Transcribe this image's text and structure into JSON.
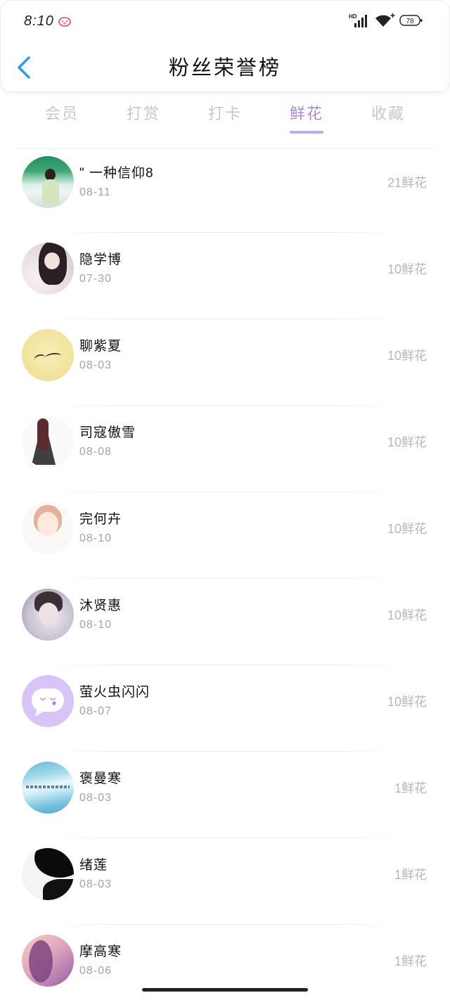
{
  "status_bar": {
    "time": "8:10",
    "network_label": "HD",
    "battery_level": "78",
    "icons": {
      "notification": "pig-icon",
      "signal": "signal-icon",
      "wifi": "wifi-icon",
      "battery": "battery-icon"
    }
  },
  "header": {
    "back_icon": "chevron-left-icon",
    "title": "粉丝荣誉榜"
  },
  "tabs": [
    {
      "label": "会员",
      "active": false
    },
    {
      "label": "打赏",
      "active": false
    },
    {
      "label": "打卡",
      "active": false
    },
    {
      "label": "鲜花",
      "active": true
    },
    {
      "label": "收藏",
      "active": false
    }
  ],
  "fans": [
    {
      "name": "\" 一种信仰8",
      "date": "08-11",
      "flowers": "21鲜花"
    },
    {
      "name": "隐学博",
      "date": "07-30",
      "flowers": "10鲜花"
    },
    {
      "name": "聊紫夏",
      "date": "08-03",
      "flowers": "10鲜花"
    },
    {
      "name": "司寇傲雪",
      "date": "08-08",
      "flowers": "10鲜花"
    },
    {
      "name": "完何卉",
      "date": "08-10",
      "flowers": "10鲜花"
    },
    {
      "name": "沐贤惠",
      "date": "08-10",
      "flowers": "10鲜花"
    },
    {
      "name": "萤火虫闪闪",
      "date": "08-07",
      "flowers": "10鲜花",
      "avatar_icon": "chat-bubble-icon"
    },
    {
      "name": "褒曼寒",
      "date": "08-03",
      "flowers": "1鲜花"
    },
    {
      "name": "绪莲",
      "date": "08-03",
      "flowers": "1鲜花"
    },
    {
      "name": "摩高寒",
      "date": "08-06",
      "flowers": "1鲜花"
    }
  ],
  "colors": {
    "accent": "#a98bd8",
    "accent_underline": "#c4aae9",
    "back_arrow": "#2c9df0",
    "tab_inactive": "#c8c8c8",
    "text_secondary": "#a3a3a3",
    "flower_count": "#b7b7b7"
  }
}
